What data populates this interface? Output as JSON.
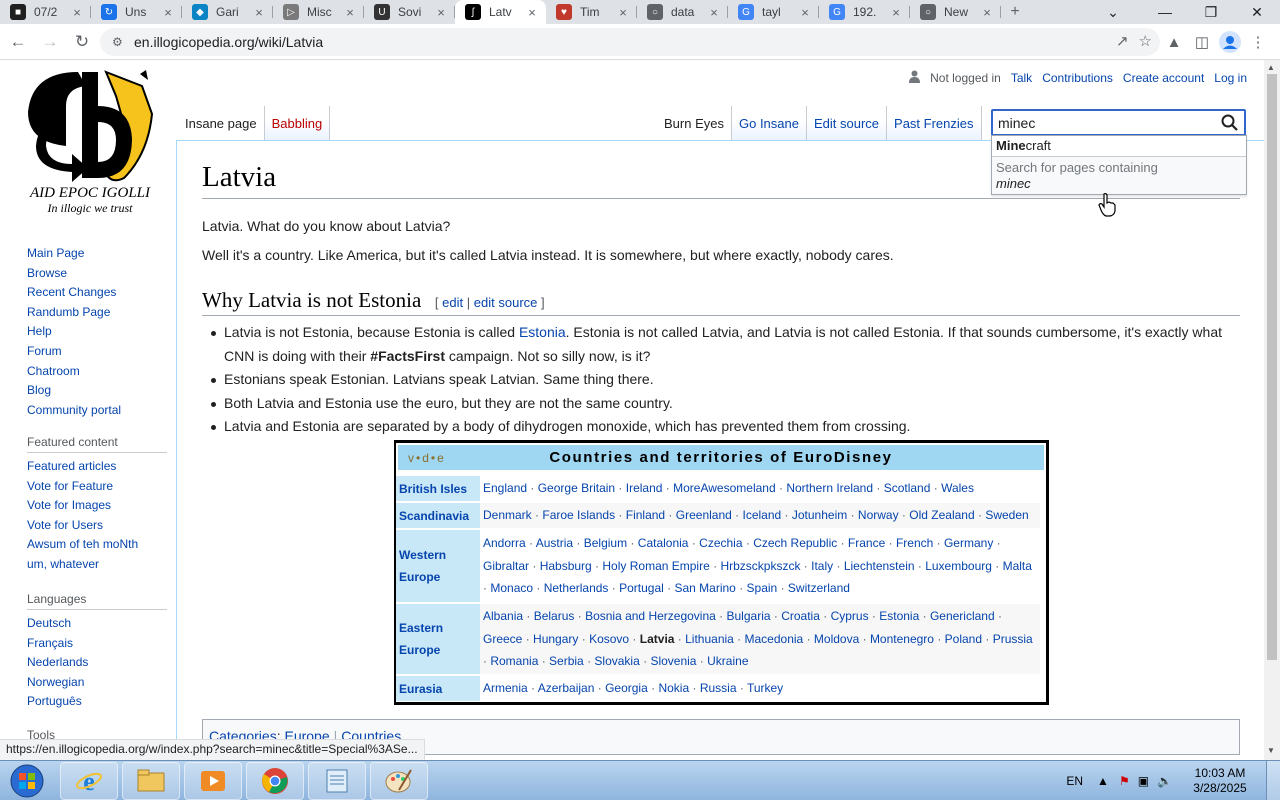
{
  "browser": {
    "tabs": [
      {
        "title": "07/2",
        "fav_color": "#1f1f1f",
        "fav_glyph": "■"
      },
      {
        "title": "Uns",
        "fav_color": "#1a73e8",
        "fav_glyph": "↻"
      },
      {
        "title": "Gari",
        "fav_color": "#0b84c6",
        "fav_glyph": "◆"
      },
      {
        "title": "Misc",
        "fav_color": "#7a7a7a",
        "fav_glyph": "▷"
      },
      {
        "title": "Sovi",
        "fav_color": "#333333",
        "fav_glyph": "U"
      },
      {
        "title": "Latv",
        "fav_color": "#000000",
        "fav_glyph": "ʃ"
      },
      {
        "title": "Tim",
        "fav_color": "#c0392b",
        "fav_glyph": "♥"
      },
      {
        "title": "data",
        "fav_color": "#5f6368",
        "fav_glyph": "○"
      },
      {
        "title": "tayl",
        "fav_color": "#4285f4",
        "fav_glyph": "G"
      },
      {
        "title": "192.",
        "fav_color": "#4285f4",
        "fav_glyph": "G"
      },
      {
        "title": "New",
        "fav_color": "#5f6368",
        "fav_glyph": "○"
      }
    ],
    "active_tab": 5,
    "url": "en.illogicopedia.org/wiki/Latvia",
    "status_url": "https://en.illogicopedia.org/w/index.php?search=minec&title=Special%3ASe..."
  },
  "wiki": {
    "logo_title": "AID EPOC IGOLLI",
    "logo_tagline": "In illogic we trust",
    "personal": {
      "not_logged_in": "Not logged in",
      "talk": "Talk",
      "contributions": "Contributions",
      "create_account": "Create account",
      "log_in": "Log in"
    },
    "tabs_left": {
      "insane_page": "Insane page",
      "babbling": "Babbling"
    },
    "tabs_right": {
      "burn_eyes": "Burn Eyes",
      "go_insane": "Go Insane",
      "edit_source": "Edit source",
      "past_frenzies": "Past Frenzies"
    },
    "search": {
      "value": "minec",
      "suggestion_bold": "Mine",
      "suggestion_rest": "craft",
      "containing_label": "Search for pages containing",
      "containing_term": "minec"
    },
    "sidebar": {
      "nav": [
        "Main Page",
        "Browse",
        "Recent Changes",
        "Randumb Page",
        "Help",
        "Forum",
        "Chatroom",
        "Blog",
        "Community portal"
      ],
      "featured_heading": "Featured content",
      "featured": [
        "Featured articles",
        "Vote for Feature",
        "Vote for Images",
        "Vote for Users",
        "Awsum of teh moNth",
        "um, whatever"
      ],
      "languages_heading": "Languages",
      "languages": [
        "Deutsch",
        "Français",
        "Nederlands",
        "Norwegian",
        "Português"
      ],
      "tools_heading": "Tools"
    },
    "article": {
      "title": "Latvia",
      "p1": "Latvia. What do you know about Latvia?",
      "p2": "Well it's a country. Like America, but it's called Latvia instead. It is somewhere, but where exactly, nobody cares.",
      "h2": "Why Latvia is not Estonia",
      "h2_edit_open": "[",
      "h2_edit": "edit",
      "h2_edit_sep": "|",
      "h2_edit_source": "edit source",
      "h2_edit_close": "]",
      "b1_a": "Latvia is not Estonia, because Estonia is called ",
      "b1_link": "Estonia",
      "b1_b": ". Estonia is not called Latvia, and Latvia is not called Estonia. If that sounds cumbersome, it's exactly what CNN is doing with their ",
      "b1_bold": "#FactsFirst",
      "b1_c": " campaign. Not so silly now, is it?",
      "b2": "Estonians speak Estonian. Latvians speak Latvian. Same thing there.",
      "b3": "Both Latvia and Estonia use the euro, but they are not the same country.",
      "b4": "Latvia and Estonia are separated by a body of dihydrogen monoxide, which has prevented them from crossing."
    },
    "navbox": {
      "vde": "v•d•e",
      "title": "Countries and territories of EuroDisney",
      "groups": [
        {
          "name": "British Isles",
          "items": [
            "England",
            "George Britain",
            "Ireland",
            "MoreAwesomeland",
            "Northern Ireland",
            "Scotland",
            "Wales"
          ]
        },
        {
          "name": "Scandinavia",
          "items": [
            "Denmark",
            "Faroe Islands",
            "Finland",
            "Greenland",
            "Iceland",
            "Jotunheim",
            "Norway",
            "Old Zealand",
            "Sweden"
          ]
        },
        {
          "name": "Western Europe",
          "items": [
            "Andorra",
            "Austria",
            "Belgium",
            "Catalonia",
            "Czechia",
            "Czech Republic",
            "France",
            "French",
            "Germany",
            "Gibraltar",
            "Habsburg",
            "Holy Roman Empire",
            "Hrbzsckpkszck",
            "Italy",
            "Liechtenstein",
            "Luxembourg",
            "Malta",
            "Monaco",
            "Netherlands",
            "Portugal",
            "San Marino",
            "Spain",
            "Switzerland"
          ]
        },
        {
          "name": "Eastern Europe",
          "items": [
            "Albania",
            "Belarus",
            "Bosnia and Herzegovina",
            "Bulgaria",
            "Croatia",
            "Cyprus",
            "Estonia",
            "Genericland",
            "Greece",
            "Hungary",
            "Kosovo",
            "Latvia",
            "Lithuania",
            "Macedonia",
            "Moldova",
            "Montenegro",
            "Poland",
            "Prussia",
            "Romania",
            "Serbia",
            "Slovakia",
            "Slovenia",
            "Ukraine"
          ]
        },
        {
          "name": "Eurasia",
          "items": [
            "Armenia",
            "Azerbaijan",
            "Georgia",
            "Nokia",
            "Russia",
            "Turkey"
          ]
        }
      ],
      "current": "Latvia"
    },
    "categories": {
      "label": "Categories",
      "items": [
        "Europe",
        "Countries"
      ]
    }
  },
  "taskbar": {
    "lang": "EN",
    "time": "10:03 AM",
    "date": "3/28/2025"
  },
  "colors": {
    "link": "#0645ad",
    "new_link": "#ba0000",
    "navbox_header": "#9fd7f3",
    "navbox_group": "#c8e7f7"
  },
  "icons": [
    "search-icon",
    "user-icon",
    "back-icon",
    "forward-icon",
    "reload-icon",
    "share-icon",
    "star-icon",
    "extension-icon",
    "sidepanel-icon",
    "profile-icon",
    "menu-icon",
    "windows-start-icon",
    "ie-icon",
    "explorer-icon",
    "media-player-icon",
    "chrome-icon",
    "notepad-icon",
    "paint-icon",
    "hand-cursor-icon"
  ]
}
